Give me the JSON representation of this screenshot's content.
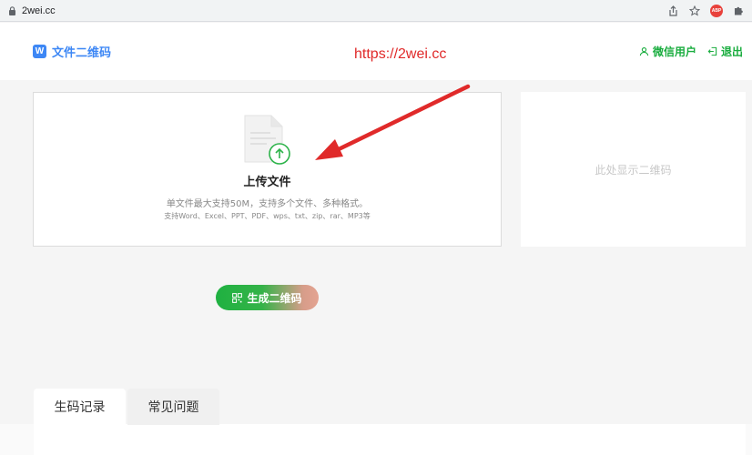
{
  "browser": {
    "url": "2wei.cc",
    "icons": [
      "lock-icon",
      "share-icon",
      "star-icon",
      "adblock-icon",
      "extensions-icon"
    ],
    "adblock_label": "ABP"
  },
  "header": {
    "logo_letter": "W",
    "logo_text": "文件二维码",
    "annotation_url": "https://2wei.cc",
    "user_link": "微信用户",
    "logout_link": "退出"
  },
  "upload": {
    "title": "上传文件",
    "hint": "单文件最大支持50M，支持多个文件、多种格式。",
    "formats": "支持Word、Excel、PPT、PDF、wps、txt、zip、rar、MP3等"
  },
  "qr_preview": {
    "placeholder": "此处显示二维码"
  },
  "generate_button": {
    "label": "生成二维码"
  },
  "tabs": [
    {
      "label": "生码记录",
      "active": true
    },
    {
      "label": "常见问题",
      "active": false
    }
  ],
  "colors": {
    "brand_blue": "#3d87f5",
    "brand_green": "#1aad3f",
    "annotation_red": "#e02a2a"
  }
}
